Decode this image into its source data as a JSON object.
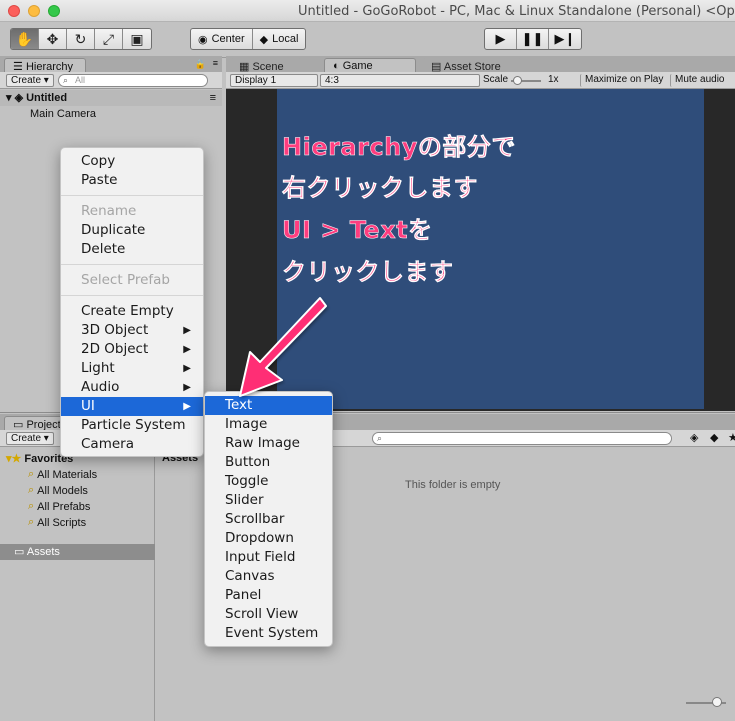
{
  "window": {
    "title": "Untitled - GoGoRobot - PC, Mac & Linux Standalone (Personal) <OpenGL"
  },
  "toolbar": {
    "pivot_label": "Center",
    "space_label": "Local"
  },
  "hierarchy": {
    "tab_label": "Hierarchy",
    "create_label": "Create ▾",
    "search_placeholder": "All",
    "scene_name": "Untitled",
    "objects": [
      "Main Camera"
    ]
  },
  "scene_tabs": {
    "scene": "Scene",
    "game": "Game",
    "asset_store": "Asset Store"
  },
  "game_bar": {
    "display": "Display 1",
    "aspect": "4:3",
    "scale_label": "Scale",
    "scale_value": "1x",
    "maximize": "Maximize on Play",
    "mute": "Mute audio"
  },
  "project": {
    "tab_label": "Project",
    "create_label": "Create ▾",
    "favorites_label": "Favorites",
    "favorites": [
      "All Materials",
      "All Models",
      "All Prefabs",
      "All Scripts"
    ],
    "assets_label": "Assets",
    "breadcrumb": "Assets",
    "empty_text": "This folder is empty"
  },
  "context_menu": {
    "items": [
      {
        "label": "Copy",
        "disabled": false
      },
      {
        "label": "Paste",
        "disabled": false
      },
      {
        "label": "Rename",
        "disabled": true
      },
      {
        "label": "Duplicate",
        "disabled": false
      },
      {
        "label": "Delete",
        "disabled": false
      },
      {
        "label": "Select Prefab",
        "disabled": true
      },
      {
        "label": "Create Empty",
        "disabled": false
      },
      {
        "label": "3D Object",
        "disabled": false
      },
      {
        "label": "2D Object",
        "disabled": false
      },
      {
        "label": "Light",
        "disabled": false
      },
      {
        "label": "Audio",
        "disabled": false
      },
      {
        "label": "UI",
        "disabled": false
      },
      {
        "label": "Particle System",
        "disabled": false
      },
      {
        "label": "Camera",
        "disabled": false
      }
    ]
  },
  "ui_submenu": {
    "items": [
      "Text",
      "Image",
      "Raw Image",
      "Button",
      "Toggle",
      "Slider",
      "Scrollbar",
      "Dropdown",
      "Input Field",
      "Canvas",
      "Panel",
      "Scroll View",
      "Event System"
    ],
    "selected": "Text"
  },
  "annotation": {
    "lines": [
      "Hierarchyの部分で",
      "右クリックします",
      "UI > Textを",
      "クリックします"
    ],
    "color": "#ff3d7f"
  },
  "colors": {
    "menu_highlight": "#1c68d8",
    "game_background": "#2f4d7a"
  }
}
